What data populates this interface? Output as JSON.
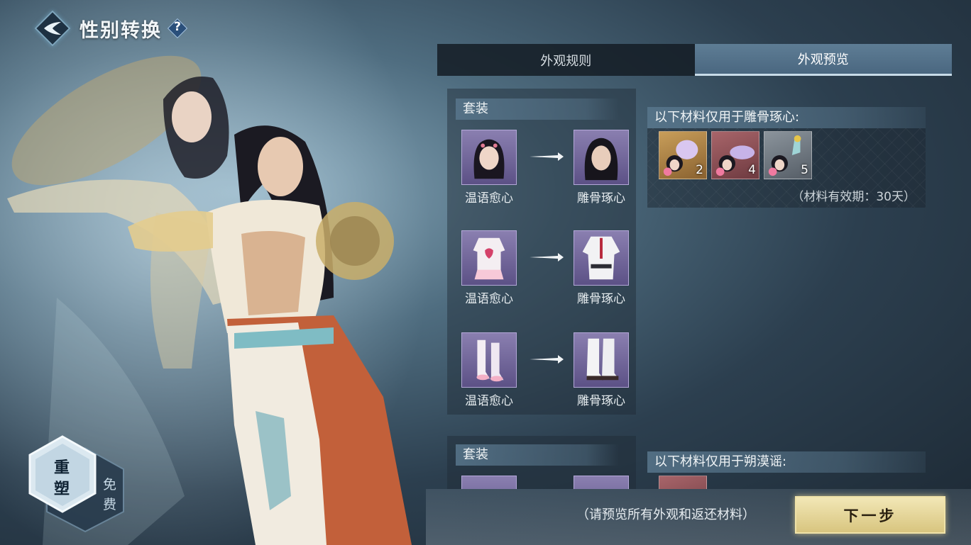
{
  "header": {
    "title": "性别转换",
    "help_label": "?"
  },
  "tabs": [
    {
      "label": "外观规则",
      "active": false
    },
    {
      "label": "外观预览",
      "active": true
    }
  ],
  "groups": [
    {
      "section_title": "套装",
      "pairs": [
        {
          "from_label": "温语愈心",
          "to_label": "雕骨琢心",
          "item": "hair"
        },
        {
          "from_label": "温语愈心",
          "to_label": "雕骨琢心",
          "item": "outfit"
        },
        {
          "from_label": "温语愈心",
          "to_label": "雕骨琢心",
          "item": "boots"
        }
      ],
      "materials_title": "以下材料仅用于雕骨琢心:",
      "materials": [
        {
          "count": "2",
          "rarity": "gold"
        },
        {
          "count": "4",
          "rarity": "red"
        },
        {
          "count": "5",
          "rarity": "grey"
        }
      ],
      "validity": "（材料有效期：30天）"
    },
    {
      "section_title": "套装",
      "materials_title": "以下材料仅用于朔漠谣:"
    }
  ],
  "reshape": {
    "line1": "重",
    "line2": "塑",
    "free_label": "免费"
  },
  "footer": {
    "hint": "（请预览所有外观和返还材料）",
    "next_label": "下一步"
  },
  "colors": {
    "accent_gold": "#d8c57f",
    "tab_active": "#5e7d95",
    "slot_purple": "#6f6499"
  }
}
